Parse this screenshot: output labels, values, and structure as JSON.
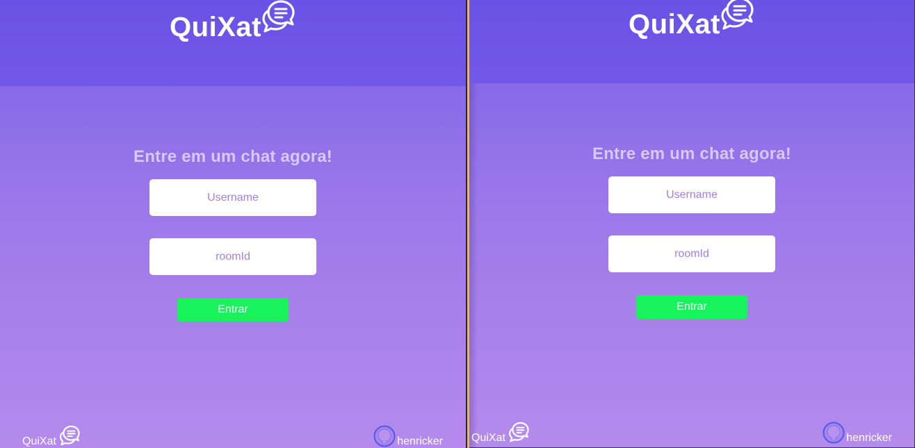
{
  "colors": {
    "header": "#6a52e6",
    "background_top": "#7a5fe6",
    "background_bottom": "#b58aec",
    "headline": "#d9c8f4",
    "input_text": "#a47fe0",
    "button": "#18f35c",
    "accent_divider": "#e7b86a"
  },
  "panes": [
    {
      "logo_text": "QuiXat",
      "logo_icon": "chat-bubbles-icon",
      "headline": "Entre em um chat agora!",
      "username_placeholder": "Username",
      "roomid_placeholder": "roomId",
      "enter_label": "Entrar",
      "footer_brand": "QuiXat",
      "footer_user": "henricker",
      "footer_user_icon": "github-icon"
    },
    {
      "logo_text": "QuiXat",
      "logo_icon": "chat-bubbles-icon",
      "headline": "Entre em um chat agora!",
      "username_placeholder": "Username",
      "roomid_placeholder": "roomId",
      "enter_label": "Entrar",
      "footer_brand": "QuiXat",
      "footer_user": "henricker",
      "footer_user_icon": "github-icon"
    }
  ]
}
